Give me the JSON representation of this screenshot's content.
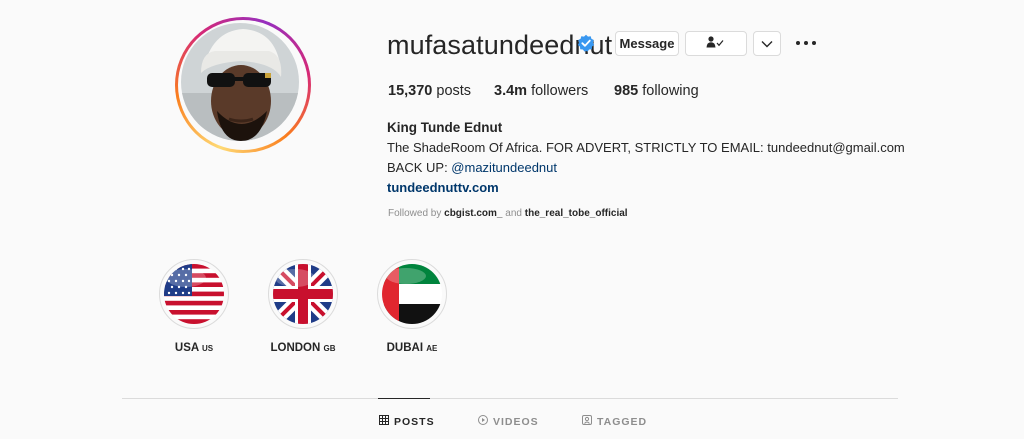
{
  "profile": {
    "username": "mufasatundeednut",
    "verified_icon": "verified-badge-icon",
    "posts_count": "15,370",
    "posts_label": "posts",
    "followers_count": "3.4m",
    "followers_label": "followers",
    "following_count": "985",
    "following_label": "following",
    "full_name": "King Tunde Ednut",
    "bio_line1": "The ShadeRoom Of Africa. FOR ADVERT, STRICTLY TO EMAIL: tundeednut@gmail.com",
    "bio_line2_prefix": "BACK UP: ",
    "bio_line2_mention": "@mazitundeednut",
    "website": "tundeednuttv.com",
    "followed_by_prefix": "Followed by ",
    "followed_by_user1": "cbgist.com_",
    "followed_by_and": " and ",
    "followed_by_user2": "the_real_tobe_official"
  },
  "actions": {
    "message_label": "Message",
    "following_icon": "person-check-icon",
    "suggest_icon": "chevron-down-icon",
    "more_icon": "more-options-icon"
  },
  "highlights": [
    {
      "title": "USA",
      "code": "US",
      "image": "us-flag"
    },
    {
      "title": "LONDON",
      "code": "GB",
      "image": "gb-flag"
    },
    {
      "title": "DUBAI",
      "code": "AE",
      "image": "ae-flag"
    }
  ],
  "tabs": [
    {
      "label": "POSTS",
      "icon": "grid-icon",
      "active": true
    },
    {
      "label": "VIDEOS",
      "icon": "play-icon",
      "active": false
    },
    {
      "label": "TAGGED",
      "icon": "tag-icon",
      "active": false
    }
  ],
  "colors": {
    "link": "#00376b",
    "verified": "#3897f0",
    "muted": "#8e8e8e",
    "border": "#dbdbdb"
  }
}
